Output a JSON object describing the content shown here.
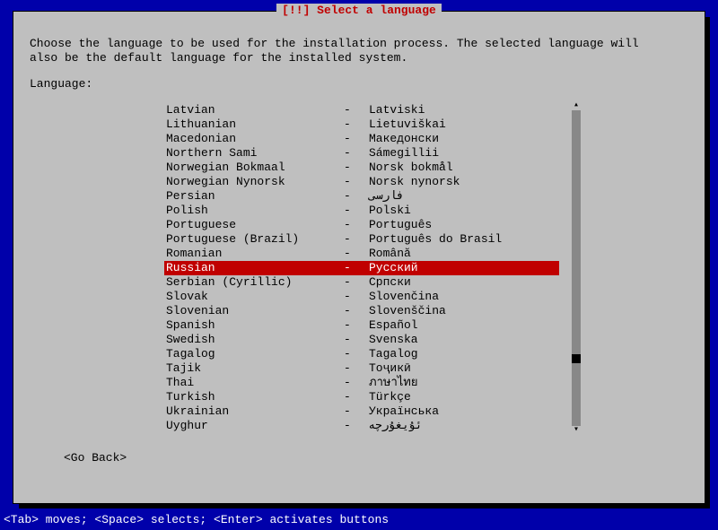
{
  "title": "[!!] Select a language",
  "instruction": "Choose the language to be used for the installation process. The selected language will\nalso be the default language for the installed system.",
  "label": "Language:",
  "goBack": "<Go Back>",
  "footer": "<Tab> moves; <Space> selects; <Enter> activates buttons",
  "selectedIndex": 11,
  "languages": [
    {
      "name": "Latvian",
      "native": "Latviski"
    },
    {
      "name": "Lithuanian",
      "native": "Lietuviškai"
    },
    {
      "name": "Macedonian",
      "native": "Македонски"
    },
    {
      "name": "Northern Sami",
      "native": "Sámegillii"
    },
    {
      "name": "Norwegian Bokmaal",
      "native": "Norsk bokmål"
    },
    {
      "name": "Norwegian Nynorsk",
      "native": "Norsk nynorsk"
    },
    {
      "name": "Persian",
      "native": "فارسی"
    },
    {
      "name": "Polish",
      "native": "Polski"
    },
    {
      "name": "Portuguese",
      "native": "Português"
    },
    {
      "name": "Portuguese (Brazil)",
      "native": "Português do Brasil"
    },
    {
      "name": "Romanian",
      "native": "Română"
    },
    {
      "name": "Russian",
      "native": "Русский"
    },
    {
      "name": "Serbian (Cyrillic)",
      "native": "Српски"
    },
    {
      "name": "Slovak",
      "native": "Slovenčina"
    },
    {
      "name": "Slovenian",
      "native": "Slovenščina"
    },
    {
      "name": "Spanish",
      "native": "Español"
    },
    {
      "name": "Swedish",
      "native": "Svenska"
    },
    {
      "name": "Tagalog",
      "native": "Tagalog"
    },
    {
      "name": "Tajik",
      "native": "Тоҷикӣ"
    },
    {
      "name": "Thai",
      "native": "ภาษาไทย"
    },
    {
      "name": "Turkish",
      "native": "Türkçe"
    },
    {
      "name": "Ukrainian",
      "native": "Українська"
    },
    {
      "name": "Uyghur",
      "native": "ئۇيغۇرچە"
    }
  ]
}
